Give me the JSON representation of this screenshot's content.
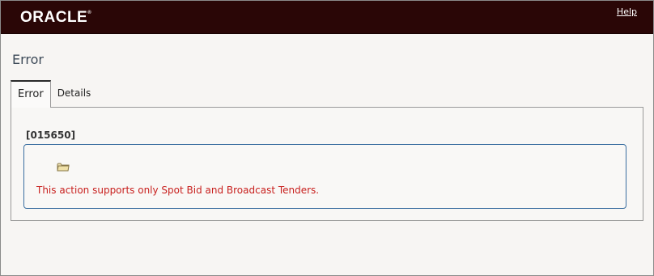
{
  "header": {
    "logo_text": "ORACLE",
    "help_label": "Help",
    "background_color": "#2a0606"
  },
  "page": {
    "title": "Error"
  },
  "tabs": [
    {
      "label": "Error",
      "active": true
    },
    {
      "label": "Details",
      "active": false
    }
  ],
  "error": {
    "code": "[015650]",
    "icon": "folder-icon",
    "message": "This action supports only Spot Bid and Broadcast Tenders.",
    "message_color": "#c8201e",
    "box_border_color": "#3b6fa0"
  }
}
